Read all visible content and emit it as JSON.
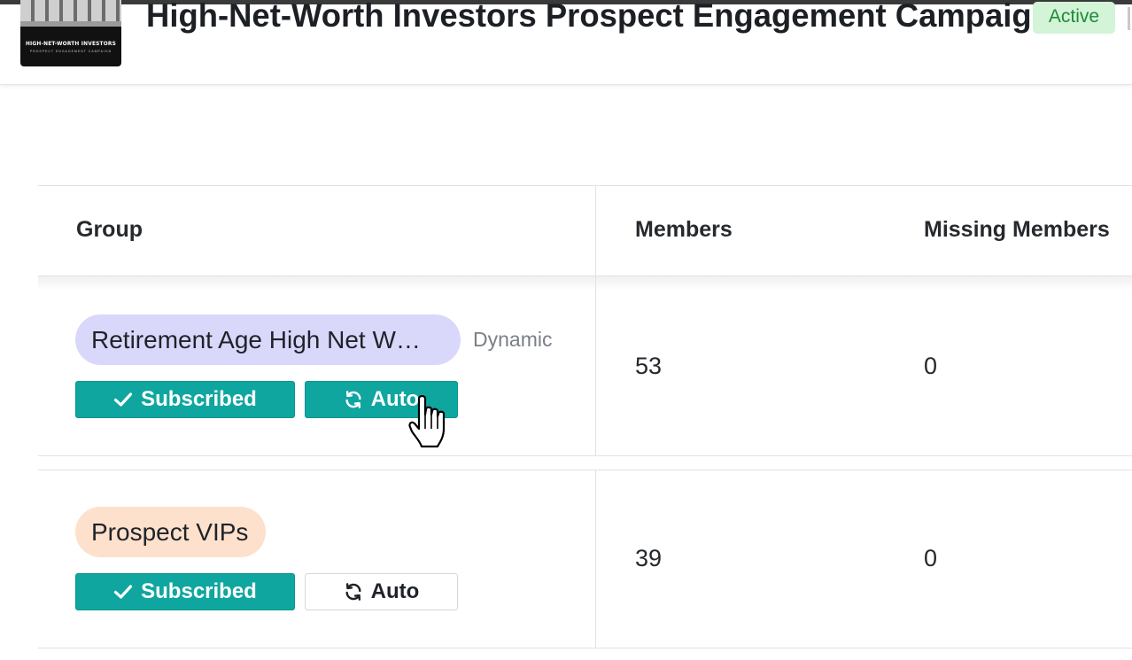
{
  "header": {
    "logo": {
      "title": "HIGH-NET-WORTH INVESTORS",
      "subtitle": "PROSPECT ENGAGEMENT CAMPAIGN"
    },
    "title": "High-Net-Worth Investors Prospect Engagement Campaign",
    "status": "Active"
  },
  "table": {
    "columns": {
      "group": "Group",
      "members": "Members",
      "missing_members": "Missing Members"
    },
    "rows": [
      {
        "group_name": "Retirement Age High Net W…",
        "group_type": "Dynamic",
        "group_color": "#d9d8fb",
        "subscribed_label": "Subscribed",
        "auto_label": "Auto",
        "auto_active": true,
        "members": "53",
        "missing_members": "0"
      },
      {
        "group_name": "Prospect VIPs",
        "group_color": "#fde1cd",
        "subscribed_label": "Subscribed",
        "auto_label": "Auto",
        "auto_active": false,
        "members": "39",
        "missing_members": "0"
      }
    ]
  },
  "colors": {
    "accent_teal": "#0fa6a0",
    "status_bg": "#d3f4d6",
    "status_text": "#1e8a3c"
  },
  "icons": [
    "check-icon",
    "refresh-icon",
    "hand-pointer-cursor"
  ]
}
